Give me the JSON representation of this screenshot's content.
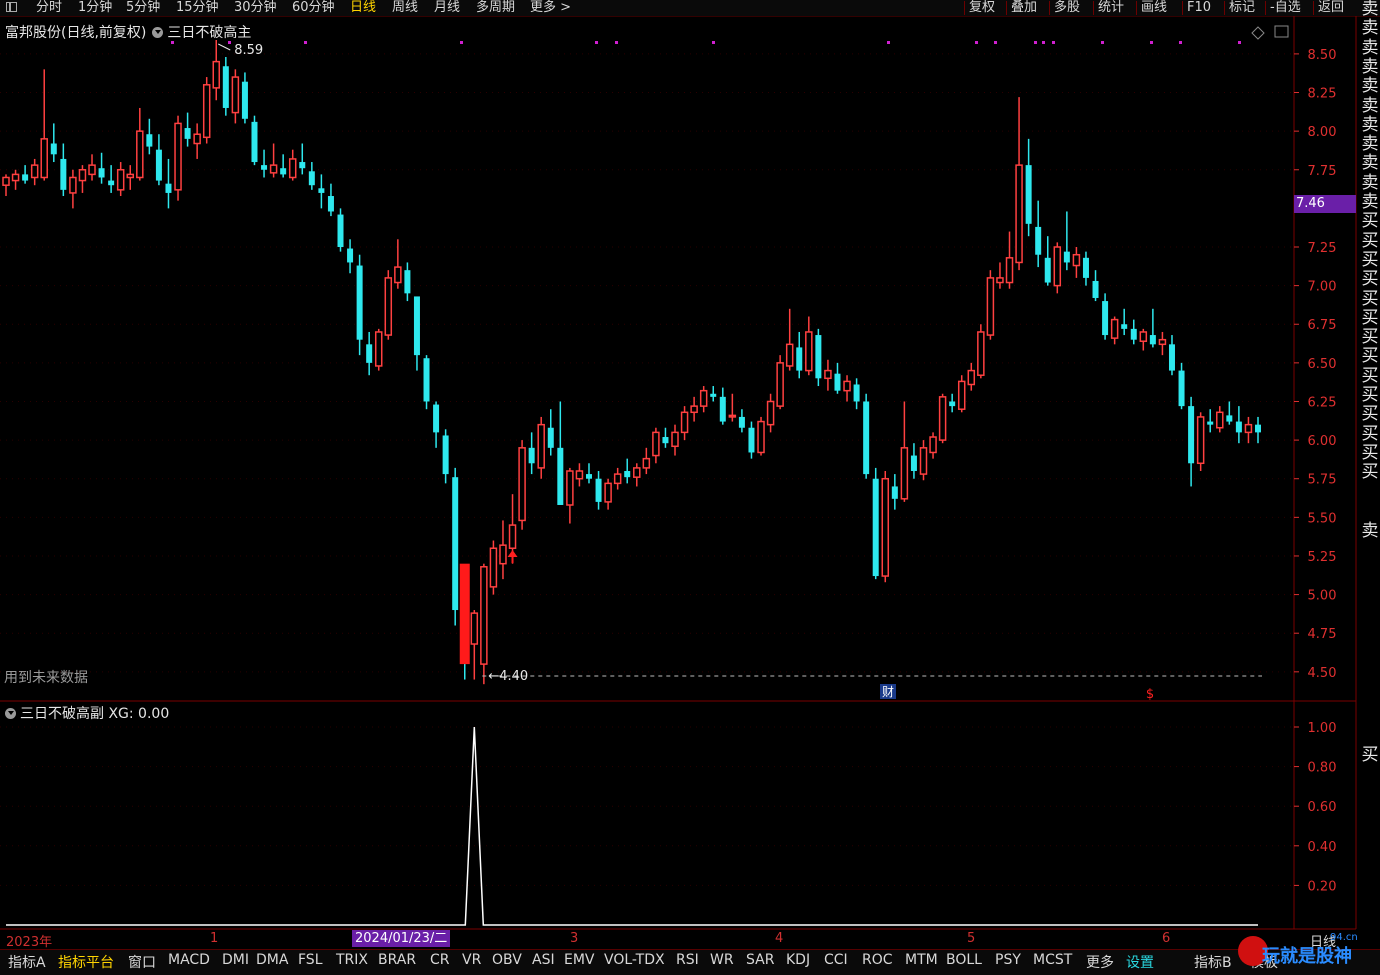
{
  "top_tabs": [
    "分时",
    "1分钟",
    "5分钟",
    "15分钟",
    "30分钟",
    "60分钟",
    "日线",
    "周线",
    "月线",
    "多周期",
    "更多 >"
  ],
  "active_tab": "日线",
  "top_right": [
    "复权",
    "叠加",
    "多股",
    "统计",
    "画线",
    "F10",
    "标记",
    "-自选",
    "返回"
  ],
  "title": {
    "stock": "富邦股份(日线,前复权)",
    "formula": "三日不破高主"
  },
  "future_note": "用到未来数据",
  "max_label": "8.59",
  "min_label": "4.40",
  "current_price": "7.46",
  "price_axis": [
    "8.50",
    "8.25",
    "8.00",
    "7.75",
    "7.25",
    "7.00",
    "6.75",
    "6.50",
    "6.25",
    "6.00",
    "5.75",
    "5.50",
    "5.25",
    "5.00",
    "4.75",
    "4.50"
  ],
  "sub_title": "三日不破高副  XG: 0.00",
  "sub_axis": [
    "1.00",
    "0.80",
    "0.60",
    "0.40",
    "0.20"
  ],
  "side_main": [
    "卖",
    "卖",
    "卖",
    "卖",
    "卖",
    "卖",
    "卖",
    "卖",
    "卖",
    "卖",
    "卖",
    "买",
    "买",
    "买",
    "买",
    "买",
    "买",
    "买",
    "买",
    "买",
    "买",
    "买",
    "买",
    "买",
    "买"
  ],
  "side_single": "卖",
  "side_sub": "买",
  "events": {
    "cai": "财",
    "s": "$"
  },
  "time_axis": {
    "year": "2023年",
    "m1": "1",
    "date": "2024/01/23/二",
    "m3": "3",
    "m4": "4",
    "m5": "5",
    "m6": "6",
    "period": "日线"
  },
  "bottom_indicators": [
    "指标A",
    "指标平台",
    "窗口",
    "MACD",
    "DMI",
    "DMA",
    "FSL",
    "TRIX",
    "BRAR",
    "CR",
    "VR",
    "OBV",
    "ASI",
    "EMV",
    "VOL-TDX",
    "RSI",
    "WR",
    "SAR",
    "KDJ",
    "CCI",
    "ROC",
    "MTM",
    "BOLL",
    "PSY",
    "MCST",
    "更多",
    "设置",
    "指标B",
    "模板"
  ],
  "logo": {
    "text": "玩就是股神",
    "domain": "94.cn"
  },
  "colors": {
    "up": "#ff4040",
    "down": "#2ee8ee",
    "axis": "#e03030",
    "purple": "#6a1fa8",
    "highlight": "#ffd400",
    "dot": "#d020d0"
  },
  "chart_data": {
    "type": "candlestick",
    "ylim": [
      4.35,
      8.7
    ],
    "candles": [
      [
        7.65,
        7.72,
        7.58,
        7.7
      ],
      [
        7.68,
        7.75,
        7.62,
        7.72
      ],
      [
        7.72,
        7.78,
        7.66,
        7.68
      ],
      [
        7.7,
        7.82,
        7.65,
        7.78
      ],
      [
        7.7,
        8.4,
        7.68,
        7.95
      ],
      [
        7.92,
        8.05,
        7.8,
        7.85
      ],
      [
        7.82,
        7.92,
        7.58,
        7.62
      ],
      [
        7.6,
        7.75,
        7.5,
        7.7
      ],
      [
        7.68,
        7.78,
        7.6,
        7.75
      ],
      [
        7.72,
        7.85,
        7.68,
        7.78
      ],
      [
        7.76,
        7.86,
        7.66,
        7.7
      ],
      [
        7.68,
        7.78,
        7.6,
        7.65
      ],
      [
        7.62,
        7.8,
        7.58,
        7.75
      ],
      [
        7.7,
        7.78,
        7.62,
        7.72
      ],
      [
        7.7,
        8.15,
        7.68,
        8.0
      ],
      [
        7.98,
        8.08,
        7.85,
        7.9
      ],
      [
        7.88,
        7.98,
        7.65,
        7.68
      ],
      [
        7.66,
        7.82,
        7.5,
        7.6
      ],
      [
        7.62,
        8.1,
        7.55,
        8.05
      ],
      [
        8.02,
        8.12,
        7.9,
        7.95
      ],
      [
        7.92,
        8.05,
        7.82,
        7.98
      ],
      [
        7.96,
        8.35,
        7.92,
        8.3
      ],
      [
        8.28,
        8.59,
        8.2,
        8.45
      ],
      [
        8.42,
        8.48,
        8.1,
        8.15
      ],
      [
        8.12,
        8.4,
        8.05,
        8.35
      ],
      [
        8.32,
        8.38,
        8.05,
        8.08
      ],
      [
        8.06,
        8.1,
        7.78,
        7.8
      ],
      [
        7.78,
        7.88,
        7.7,
        7.75
      ],
      [
        7.73,
        7.92,
        7.7,
        7.78
      ],
      [
        7.76,
        7.85,
        7.7,
        7.72
      ],
      [
        7.7,
        7.88,
        7.68,
        7.82
      ],
      [
        7.8,
        7.92,
        7.72,
        7.76
      ],
      [
        7.74,
        7.8,
        7.62,
        7.65
      ],
      [
        7.63,
        7.72,
        7.5,
        7.6
      ],
      [
        7.58,
        7.66,
        7.45,
        7.48
      ],
      [
        7.46,
        7.5,
        7.22,
        7.25
      ],
      [
        7.24,
        7.3,
        7.08,
        7.15
      ],
      [
        7.13,
        7.2,
        6.55,
        6.65
      ],
      [
        6.62,
        6.7,
        6.42,
        6.5
      ],
      [
        6.48,
        6.72,
        6.45,
        6.7
      ],
      [
        6.68,
        7.1,
        6.65,
        7.05
      ],
      [
        7.02,
        7.3,
        6.98,
        7.12
      ],
      [
        7.1,
        7.15,
        6.9,
        6.95
      ],
      [
        6.93,
        6.85,
        6.45,
        6.55
      ],
      [
        6.53,
        6.55,
        6.2,
        6.25
      ],
      [
        6.23,
        6.25,
        5.95,
        6.05
      ],
      [
        6.03,
        6.07,
        5.72,
        5.78
      ],
      [
        5.76,
        5.82,
        4.8,
        4.9
      ],
      [
        4.88,
        4.95,
        4.45,
        4.7
      ],
      [
        4.68,
        4.9,
        4.45,
        4.88
      ],
      [
        4.55,
        5.2,
        4.42,
        5.18
      ],
      [
        5.05,
        5.35,
        5.0,
        5.3
      ],
      [
        5.2,
        5.48,
        5.1,
        5.32
      ],
      [
        5.3,
        5.65,
        5.2,
        5.45
      ],
      [
        5.48,
        6.0,
        5.42,
        5.95
      ],
      [
        5.95,
        6.05,
        5.78,
        5.85
      ],
      [
        5.82,
        6.15,
        5.75,
        6.1
      ],
      [
        6.08,
        6.2,
        5.9,
        5.95
      ],
      [
        5.95,
        6.25,
        5.88,
        5.58
      ],
      [
        5.58,
        5.82,
        5.46,
        5.8
      ],
      [
        5.75,
        5.85,
        5.7,
        5.8
      ],
      [
        5.78,
        5.85,
        5.72,
        5.75
      ],
      [
        5.75,
        5.8,
        5.55,
        5.6
      ],
      [
        5.6,
        5.75,
        5.55,
        5.72
      ],
      [
        5.72,
        5.82,
        5.68,
        5.78
      ],
      [
        5.8,
        5.88,
        5.72,
        5.76
      ],
      [
        5.76,
        5.85,
        5.7,
        5.82
      ],
      [
        5.82,
        5.95,
        5.78,
        5.88
      ],
      [
        5.9,
        6.08,
        5.85,
        6.05
      ],
      [
        6.02,
        6.08,
        5.95,
        5.98
      ],
      [
        5.96,
        6.1,
        5.9,
        6.05
      ],
      [
        6.05,
        6.22,
        6.0,
        6.18
      ],
      [
        6.18,
        6.28,
        6.12,
        6.22
      ],
      [
        6.22,
        6.35,
        6.18,
        6.32
      ],
      [
        6.3,
        6.35,
        6.25,
        6.28
      ],
      [
        6.28,
        6.34,
        6.1,
        6.12
      ],
      [
        6.15,
        6.3,
        6.12,
        6.16
      ],
      [
        6.15,
        6.2,
        6.05,
        6.08
      ],
      [
        6.08,
        6.12,
        5.88,
        5.92
      ],
      [
        5.92,
        6.15,
        5.9,
        6.12
      ],
      [
        6.1,
        6.3,
        6.05,
        6.25
      ],
      [
        6.22,
        6.55,
        6.2,
        6.5
      ],
      [
        6.48,
        6.85,
        6.45,
        6.62
      ],
      [
        6.6,
        6.7,
        6.4,
        6.45
      ],
      [
        6.45,
        6.8,
        6.42,
        6.7
      ],
      [
        6.68,
        6.72,
        6.35,
        6.4
      ],
      [
        6.4,
        6.52,
        6.32,
        6.45
      ],
      [
        6.43,
        6.5,
        6.3,
        6.32
      ],
      [
        6.32,
        6.42,
        6.25,
        6.38
      ],
      [
        6.36,
        6.4,
        6.2,
        6.25
      ],
      [
        6.25,
        6.3,
        5.75,
        5.78
      ],
      [
        5.75,
        5.82,
        5.1,
        5.12
      ],
      [
        5.12,
        5.8,
        5.08,
        5.75
      ],
      [
        5.7,
        5.78,
        5.55,
        5.62
      ],
      [
        5.62,
        6.25,
        5.6,
        5.95
      ],
      [
        5.9,
        5.98,
        5.75,
        5.8
      ],
      [
        5.78,
        6.0,
        5.74,
        5.95
      ],
      [
        5.92,
        6.05,
        5.88,
        6.02
      ],
      [
        6.0,
        6.3,
        5.98,
        6.28
      ],
      [
        6.25,
        6.3,
        6.18,
        6.22
      ],
      [
        6.2,
        6.42,
        6.18,
        6.38
      ],
      [
        6.36,
        6.5,
        6.32,
        6.45
      ],
      [
        6.42,
        6.75,
        6.4,
        6.7
      ],
      [
        6.68,
        7.1,
        6.65,
        7.05
      ],
      [
        7.02,
        7.15,
        6.98,
        7.05
      ],
      [
        7.02,
        7.35,
        6.98,
        7.18
      ],
      [
        7.15,
        8.22,
        7.1,
        7.78
      ],
      [
        7.78,
        7.95,
        7.32,
        7.4
      ],
      [
        7.38,
        7.55,
        7.12,
        7.2
      ],
      [
        7.18,
        7.32,
        7.0,
        7.02
      ],
      [
        7.0,
        7.28,
        6.95,
        7.25
      ],
      [
        7.22,
        7.48,
        7.1,
        7.15
      ],
      [
        7.13,
        7.25,
        7.05,
        7.2
      ],
      [
        7.18,
        7.22,
        7.0,
        7.05
      ],
      [
        7.03,
        7.1,
        6.9,
        6.92
      ],
      [
        6.9,
        6.95,
        6.65,
        6.68
      ],
      [
        6.66,
        6.8,
        6.62,
        6.78
      ],
      [
        6.75,
        6.85,
        6.68,
        6.72
      ],
      [
        6.72,
        6.78,
        6.62,
        6.65
      ],
      [
        6.64,
        6.72,
        6.58,
        6.7
      ],
      [
        6.68,
        6.85,
        6.6,
        6.62
      ],
      [
        6.62,
        6.7,
        6.55,
        6.65
      ],
      [
        6.62,
        6.68,
        6.42,
        6.45
      ],
      [
        6.45,
        6.5,
        6.2,
        6.22
      ],
      [
        6.22,
        6.28,
        5.7,
        5.85
      ],
      [
        5.85,
        6.18,
        5.8,
        6.15
      ],
      [
        6.12,
        6.2,
        6.05,
        6.1
      ],
      [
        6.08,
        6.22,
        6.05,
        6.18
      ],
      [
        6.16,
        6.25,
        6.1,
        6.12
      ],
      [
        6.12,
        6.22,
        5.98,
        6.05
      ],
      [
        6.05,
        6.15,
        5.98,
        6.1
      ],
      [
        6.1,
        6.15,
        5.98,
        6.05
      ]
    ],
    "xg_signal_index": 49
  }
}
